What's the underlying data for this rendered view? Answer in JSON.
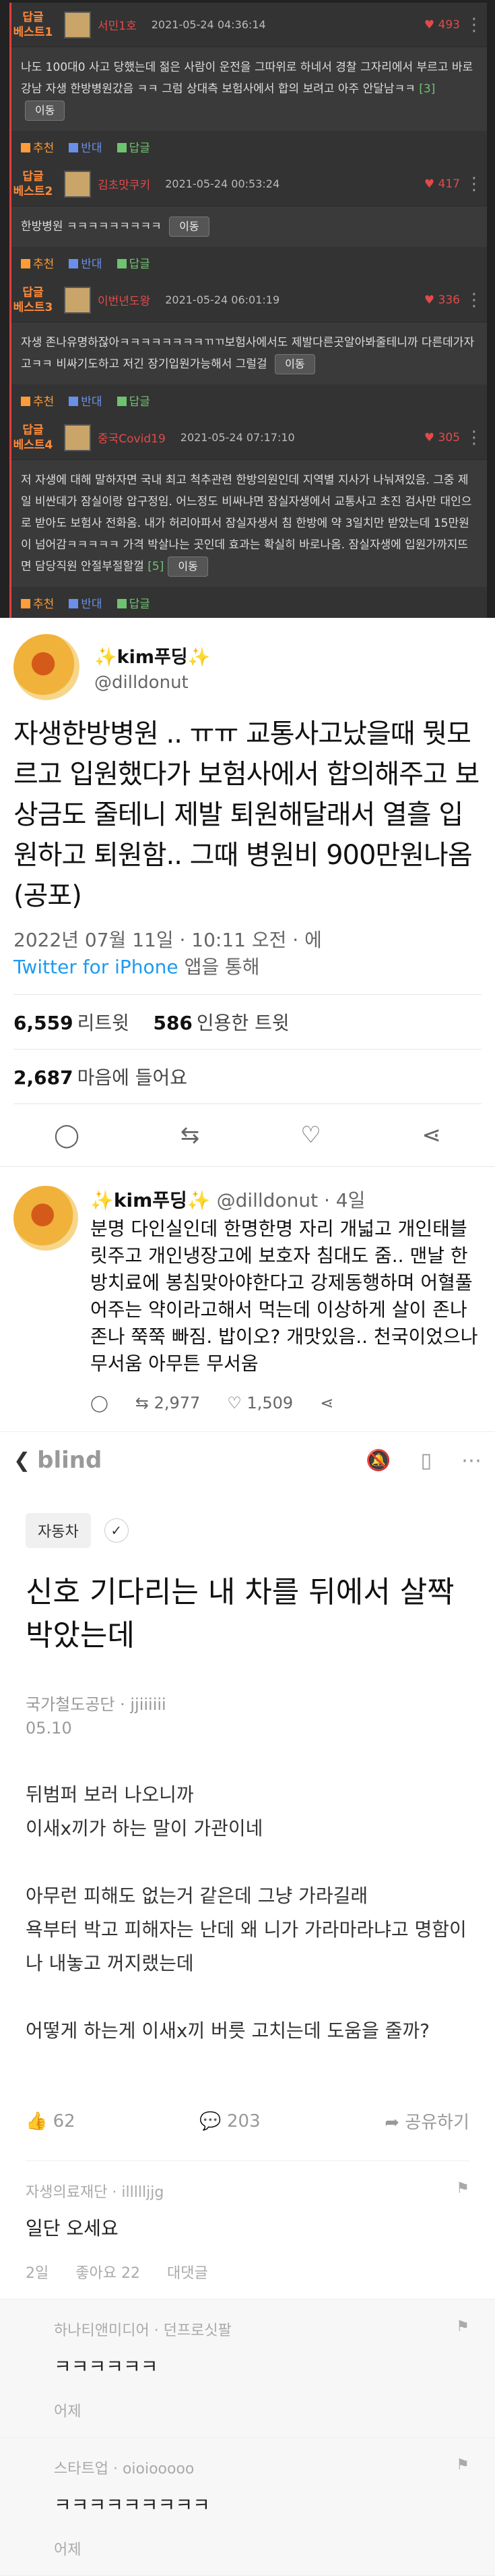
{
  "comments": [
    {
      "badge": "답글\n베스트1",
      "nick": "서민1호",
      "date": "2021-05-24 04:36:14",
      "likes": "493",
      "text": "나도 100대0 사고 당했는데 젊은 사람이 운전을 그따위로 하네서 경찰 그자리에서 부르고 바로 강남 자생 한방병원갔음 ㅋㅋ 그럼 상대측 보험사에서 합의 보려고 아주 안달남ㅋㅋ",
      "count": "[3]",
      "move": "이동",
      "rec": "추천",
      "opp": "반대",
      "rep": "답글"
    },
    {
      "badge": "답글\n베스트2",
      "nick": "김초맛쿠키",
      "date": "2021-05-24 00:53:24",
      "likes": "417",
      "text": "한방병원 ㅋㅋㅋㅋㅋㅋㅋㅋㅋ",
      "count": "",
      "move": "이동",
      "rec": "추천",
      "opp": "반대",
      "rep": "답글"
    },
    {
      "badge": "답글\n베스트3",
      "nick": "이번년도왕",
      "date": "2021-05-24 06:01:19",
      "likes": "336",
      "text": "자생 존나유명하잖아ㅋㅋㅋㅋㅋㅋㅋㅋㄲㄲ보험사에서도 제발다른곳알아봐줄테니까 다른데가자고ㅋㅋ 비싸기도하고 저긴 장기입원가능해서 그럴걸",
      "count": "",
      "move": "이동",
      "rec": "추천",
      "opp": "반대",
      "rep": "답글"
    },
    {
      "badge": "답글\n베스트4",
      "nick": "중국Covid19",
      "date": "2021-05-24 07:17:10",
      "likes": "305",
      "text": "저 자생에 대해 말하자면 국내 최고 척추관련 한방의원인데 지역별 지사가 나눠져있음. 그중 제일 비싼데가 잠실이랑 압구정임. 어느정도 비싸냐면 잠실자생에서 교통사고 초진 검사만 대인으로 받아도 보험사 전화옴. 내가 허리아파서 잠실자생서 침 한방에 약 3일치만 받았는데 15만원이 넘어감ㅋㅋㅋㅋㅋ 가격 박살나는 곳인데 효과는 확실히 바로나옴. 잠실자생에 입원가까지뜨면 담당직원 안절부절할껄",
      "count": "[5]",
      "move": "이동",
      "rec": "추천",
      "opp": "반대",
      "rep": "답글"
    }
  ],
  "tweet": {
    "name": "✨kim푸딩✨",
    "handle": "@dilldonut",
    "text": "자생한방병원 .. ㅠㅠ 교통사고났을때 뭣모르고 입원했다가 보험사에서 합의해주고 보상금도 줄테니 제발 퇴원해달래서 열흘 입원하고 퇴원함.. 그때 병원비 900만원나옴 (공포)",
    "meta": "2022년 07월 11일 · 10:11 오전 · 에",
    "source": "Twitter for iPhone",
    "source_suffix": " 앱을 통해",
    "retweets": "6,559",
    "retweets_label": "리트윗",
    "quotes": "586",
    "quotes_label": "인용한 트윗",
    "likes": "2,687",
    "likes_label": "마음에 들어요"
  },
  "reply": {
    "name": "✨kim푸딩✨",
    "handle": "@dilldonut",
    "time": "· 4일",
    "text": "분명 다인실인데 한명한명 자리 개넓고 개인태블릿주고 개인냉장고에 보호자 침대도 줌.. 맨날 한방치료에 봉침맞아야한다고 강제동행하며 어혈풀어주는 약이라고해서 먹는데 이상하게 살이 존나 존나 쭉쭉 빠짐. 밥이오? 개맛있음.. 천국이었으나 무서움 아무튼 무서움",
    "retweets": "2,977",
    "likes": "1,509"
  },
  "blind": {
    "logo": "blind",
    "category": "자동차",
    "title": "신호 기다리는 내 차를 뒤에서 살짝 박았는데",
    "author": "국가철도공단 · jjiiiiii",
    "date": "05.10",
    "body": [
      "뒤범퍼 보러 나오니까",
      "이새x끼가 하는 말이 가관이네",
      "",
      "아무런 피해도 없는거 같은데 그냥 가라길래",
      "욕부터 박고 피해자는 난데 왜 니가 가라마라냐고 명함이나 내놓고 꺼지랬는데",
      "",
      "어떻게 하는게 이새x끼 버릇 고치는데 도움을 줄까?"
    ],
    "likes": "62",
    "comments": "203",
    "share": "공유하기"
  },
  "blind_comments": [
    {
      "author": "자생의료재단 · illllljjg",
      "text": "일단 오세요",
      "meta": [
        "2일",
        "좋아요 22",
        "대댓글"
      ]
    },
    {
      "author": "하나티앤미디어 · 던프로싯팔",
      "text": "ㅋㅋㅋㅋㅋㅋ",
      "meta": [
        "어제"
      ]
    },
    {
      "author": "스타트업 · oioiooooo",
      "text": "ㅋㅋㅋㅋㅋㅋㅋㅋㅋ",
      "meta": [
        "어제"
      ]
    }
  ]
}
